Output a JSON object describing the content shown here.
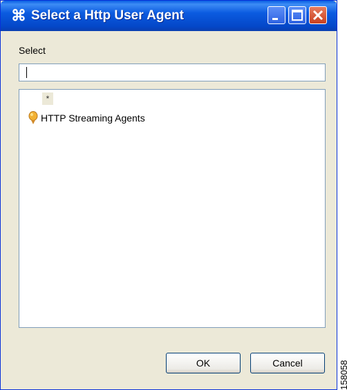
{
  "window": {
    "title": "Select a Http User Agent",
    "app_icon_glyph": "⌘",
    "title_bar_color": "#0a5fe3",
    "controls": {
      "minimize": "minimize-icon",
      "maximize": "maximize-icon",
      "close": "close-icon"
    }
  },
  "form": {
    "select_label": "Select",
    "search_value": "",
    "search_placeholder": ""
  },
  "tree": {
    "filter_marker": "*",
    "items": [
      {
        "label": "HTTP Streaming Agents",
        "icon": "agent-bulb-icon"
      }
    ]
  },
  "buttons": {
    "ok": "OK",
    "cancel": "Cancel"
  },
  "figure_id": "158058"
}
